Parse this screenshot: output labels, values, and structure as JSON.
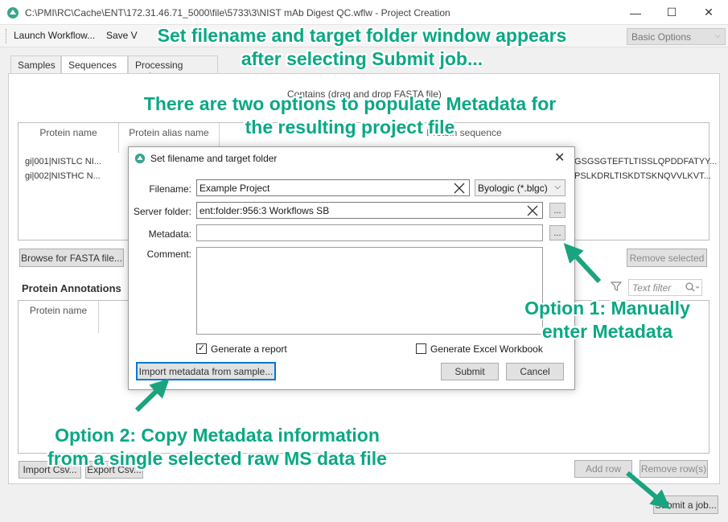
{
  "window": {
    "title": "C:\\PMI\\RC\\Cache\\ENT\\172.31.46.71_5000\\file\\5733\\3\\NIST mAb Digest QC.wflw - Project Creation",
    "minimize": "—",
    "maximize": "☐",
    "close": "✕"
  },
  "toolbar": {
    "launch_workflow": "Launch Workflow...",
    "save": "Save V",
    "basic_options": "Basic Options"
  },
  "tabs": [
    {
      "label": "Samples"
    },
    {
      "label": "Sequences"
    },
    {
      "label": "Processing nodes"
    }
  ],
  "sequences": {
    "caption": "Contains (drag and drop FASTA file)",
    "columns": [
      {
        "label": "Protein name"
      },
      {
        "label": "Protein alias name"
      },
      {
        "label": "Protein sequence"
      }
    ],
    "rows": [
      {
        "name": "gi|001|NISTLC NI...",
        "sequence_tail": "GSGSGTEFTLTISSLQPDDFATYY..."
      },
      {
        "name": "gi|002|NISTHC N...",
        "sequence_tail": "PSLKDRLTISKDTSKNQVVLKVT..."
      }
    ],
    "browse_fasta": "Browse for FASTA file...",
    "remove_selected": "Remove selected"
  },
  "annotations_panel": {
    "title": "Protein Annotations",
    "text_filter_placeholder": "Text filter",
    "columns": [
      {
        "label": "Protein name"
      }
    ],
    "import_csv": "Import Csv...",
    "export_csv": "Export Csv...",
    "add_row": "Add row",
    "remove_rows": "Remove row(s)"
  },
  "submit_job": "Submit a job...",
  "dialog": {
    "title": "Set filename and target folder",
    "filename_label": "Filename:",
    "filename_value": "Example Project",
    "file_type": "Byologic (*.blgc)",
    "server_folder_label": "Server folder:",
    "server_folder_value": "ent:folder:956:3 Workflows SB",
    "metadata_label": "Metadata:",
    "metadata_value": "",
    "comment_label": "Comment:",
    "browse": "...",
    "generate_report": "Generate a report",
    "generate_report_checked": true,
    "generate_excel": "Generate Excel Workbook",
    "generate_excel_checked": false,
    "import_metadata": "Import metadata from sample...",
    "submit": "Submit",
    "cancel": "Cancel"
  },
  "callouts": {
    "top_line1": "Set filename and target folder window appears",
    "top_line2": "after selecting Submit job...",
    "mid_line1": "There are two options to populate Metadata for",
    "mid_line2": "the resulting project file",
    "opt1_line1": "Option 1: Manually",
    "opt1_line2": "enter Metadata",
    "opt2_line1": "Option 2: Copy Metadata information",
    "opt2_line2": "from a single selected raw MS data file"
  },
  "colors": {
    "annotation": "#0aa884",
    "arrow": "#1aa37f",
    "focus_border": "#0078d7"
  }
}
